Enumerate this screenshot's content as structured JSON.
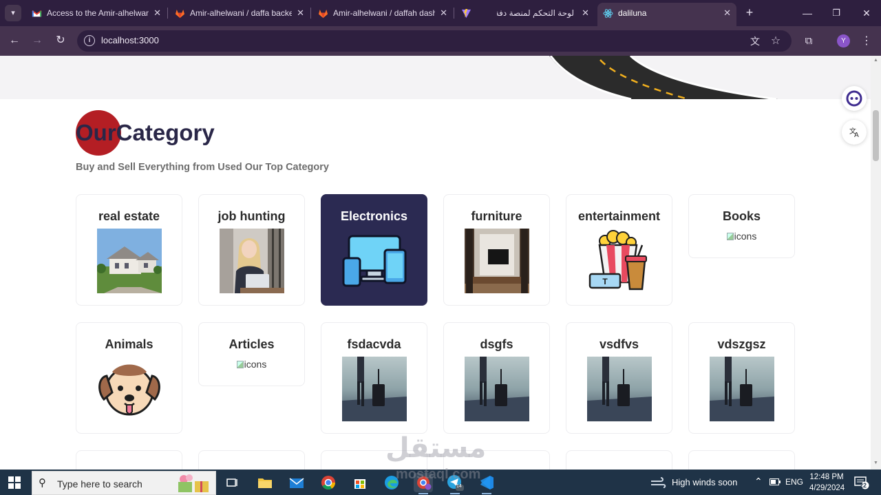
{
  "browser": {
    "tabs": [
      {
        "title": "Access to the Amir-alhelwani",
        "icon": "gmail-icon",
        "active": false
      },
      {
        "title": "Amir-alhelwani / daffa backend",
        "icon": "gitlab-icon",
        "active": false
      },
      {
        "title": "Amir-alhelwani / daffah dashboard",
        "icon": "gitlab-icon",
        "active": false
      },
      {
        "title": "",
        "icon": "vite-icon",
        "active": false
      },
      {
        "title": "لوحة التحكم لمنصة دفة",
        "icon": "",
        "active": false
      },
      {
        "title": "daliluna",
        "icon": "react-icon",
        "active": true
      }
    ],
    "url": "localhost:3000",
    "profile_initial": "Y"
  },
  "page": {
    "section_title_highlight": "Our",
    "section_title_rest": "Category",
    "subtitle": "Buy and Sell Everything from Used Our Top Category",
    "categories_row1": [
      {
        "name": "real estate",
        "image": "house-photo",
        "broken": false,
        "active": false
      },
      {
        "name": "job hunting",
        "image": "office-woman-photo",
        "broken": false,
        "active": false
      },
      {
        "name": "Electronics",
        "image": "devices-icon",
        "broken": false,
        "active": true
      },
      {
        "name": "furniture",
        "image": "living-room-photo",
        "broken": false,
        "active": false
      },
      {
        "name": "entertainment",
        "image": "popcorn-icon",
        "broken": false,
        "active": false
      },
      {
        "name": "Books",
        "image": "",
        "broken": true,
        "alt": "icons",
        "active": false
      }
    ],
    "categories_row2": [
      {
        "name": "Animals",
        "image": "dog-icon",
        "broken": false,
        "active": false
      },
      {
        "name": "Articles",
        "image": "",
        "broken": true,
        "alt": "icons",
        "active": false
      },
      {
        "name": "fsdacvda",
        "image": "traveler-photo",
        "broken": false,
        "active": false
      },
      {
        "name": "dsgfs",
        "image": "traveler-photo",
        "broken": false,
        "active": false
      },
      {
        "name": "vsdfvs",
        "image": "traveler-photo",
        "broken": false,
        "active": false
      },
      {
        "name": "vdszgsz",
        "image": "traveler-photo",
        "broken": false,
        "active": false
      }
    ],
    "colors": {
      "accent_dot": "#b41e24",
      "title": "#2a2748",
      "active_card": "#2b2a52"
    }
  },
  "watermark": {
    "text": "مستقل",
    "sub": "mostaql.com"
  },
  "taskbar": {
    "search_placeholder": "Type here to search",
    "weather": "High winds soon",
    "language": "ENG",
    "time": "12:48 PM",
    "date": "4/29/2024",
    "notification_count": "22",
    "telegram_badge": "14"
  }
}
